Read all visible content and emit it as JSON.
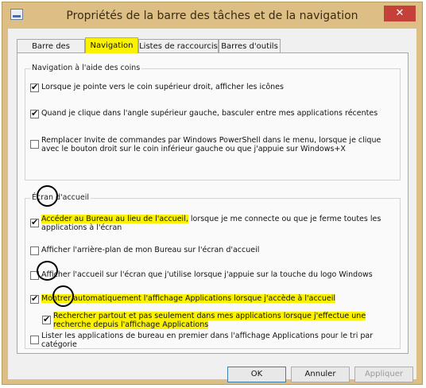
{
  "window": {
    "title": "Propriétés de la barre des tâches et de la navigation",
    "close_label": "✕"
  },
  "tabs": [
    {
      "label": "Barre des tâches",
      "active": false
    },
    {
      "label": "Navigation",
      "active": true
    },
    {
      "label": "Listes de raccourcis",
      "active": false
    },
    {
      "label": "Barres d'outils",
      "active": false
    }
  ],
  "corner_navigation": {
    "title": "Navigation à l'aide des coins",
    "options": [
      {
        "line1": "Lorsque je pointe vers le coin supérieur droit, afficher les icônes",
        "checked": true
      },
      {
        "line1": "Quand je clique dans l'angle supérieur gauche, basculer entre mes applications récentes",
        "checked": true
      },
      {
        "line1": "Remplacer Invite de commandes par Windows PowerShell dans le menu, lorsque je clique",
        "line2": "avec le bouton droit sur le coin inférieur gauche ou que j'appuie sur Windows+X",
        "checked": false
      }
    ]
  },
  "start_screen": {
    "title": "Écran d'accueil",
    "options": [
      {
        "line1_hl": "Accéder au Bureau au lieu de l'accueil,",
        "line1_rest": " lorsque je me connecte ou que je ferme toutes les",
        "line2": "applications à l'écran",
        "checked": true
      },
      {
        "line1": "Afficher l'arrière-plan de mon Bureau sur l'écran d'accueil",
        "checked": false
      },
      {
        "line1": "Afficher l'accueil sur l'écran que j'utilise lorsque j'appuie sur la touche du logo Windows",
        "checked": false
      },
      {
        "line1_hl": "Montrer automatiquement l'affichage Applications lorsque j'accède à l'accueil",
        "checked": true
      },
      {
        "line1_hl": "Rechercher partout et pas seulement dans mes applications lorsque j'effectue une",
        "line2_hl": "recherche depuis l'affichage Applications",
        "checked": true
      },
      {
        "line1": "Lister les applications de bureau en premier dans l'affichage Applications pour le tri par",
        "line2": "catégorie",
        "checked": false
      }
    ]
  },
  "buttons": {
    "ok": "OK",
    "cancel": "Annuler",
    "apply": "Appliquer"
  },
  "colors": {
    "highlight": "#fbf200",
    "frame": "#ddbf86",
    "close": "#c6403a"
  }
}
